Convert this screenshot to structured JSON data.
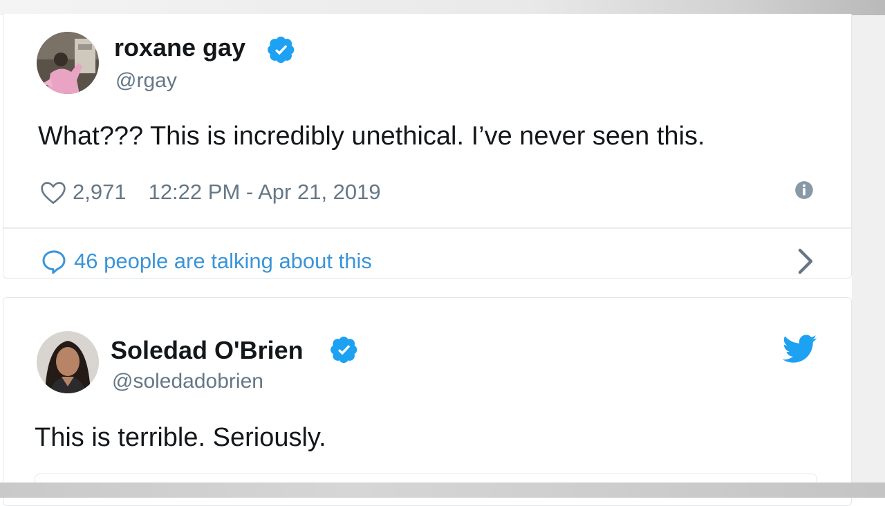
{
  "tweets": [
    {
      "name": "roxane gay",
      "handle": "@rgay",
      "text": "What??? This is incredibly unethical. I’ve never seen this.",
      "likes": "2,971",
      "timestamp": "12:22 PM - Apr 21, 2019",
      "talking": "46 people are talking about this",
      "verified": true
    },
    {
      "name": "Soledad O'Brien",
      "handle": "@soledadobrien",
      "text": "This is terrible. Seriously.",
      "verified": true
    }
  ],
  "colors": {
    "verified_blue": "#1da1f2",
    "link_blue": "#3b94d9",
    "secondary_text": "#657786",
    "primary_text": "#14171a"
  },
  "icons": [
    "verified-badge-icon",
    "heart-icon",
    "info-icon",
    "reply-icon",
    "chevron-right-icon",
    "twitter-bird-icon"
  ]
}
